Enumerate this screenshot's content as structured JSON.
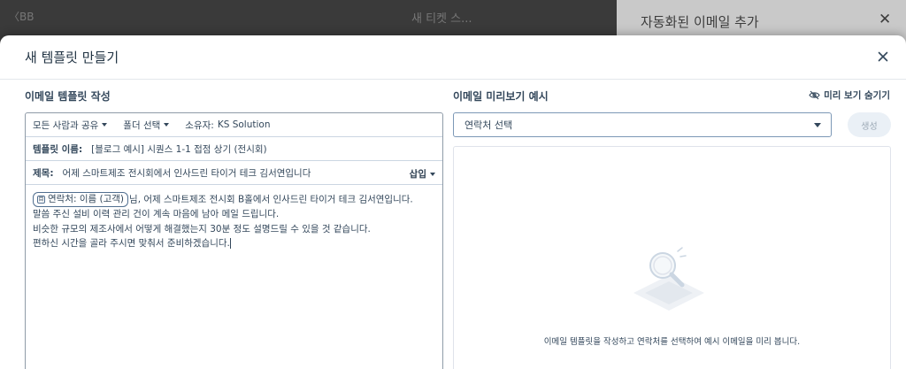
{
  "background": {
    "title": "새 티켓 스...",
    "left_text": "〈BB",
    "panel_title": "자동화된 이메일 추가",
    "panel_close": "✕"
  },
  "modal": {
    "title": "새 템플릿 만들기"
  },
  "editor": {
    "title": "이메일 템플릿 작성",
    "toolbar": {
      "share": "모든 사람과 공유",
      "folder": "폴더 선택",
      "owner_label": "소유자:",
      "owner_value": "KS Solution"
    },
    "template_name_label": "템플릿 이름:",
    "template_name_value": "[블로그 예시] 시퀀스 1-1 접점 상기 (전시회)",
    "subject_label": "제목:",
    "subject_value": "어제 스마트제조 전시회에서 인사드린 타이거 테크 김서연입니다",
    "insert_label": "삽입",
    "token_label": "연락처: 이름 (고객)",
    "token_icon": "目",
    "body_line1_rest": "님, 어제 스마트제조 전시회 B홀에서 인사드린 타이거 테크 김서연입니다.",
    "body_line2": "말씀 주신 설비 이력 관리 건이 계속 마음에 남아 메일 드립니다.",
    "body_line3": "비슷한 규모의 제조사에서 어떻게 해결했는지 30분 정도 설명드릴 수 있을 것 같습니다.",
    "body_line4": "편하신 시간을 골라 주시면 맞춰서 준비하겠습니다."
  },
  "preview": {
    "title": "이메일 미리보기 예시",
    "hide_label": "미리 보기 숨기기",
    "contact_select": "연락처 선택",
    "generate_button": "생성",
    "empty_text": "이메일 템플릿을 작성하고 연락처를 선택하여 예시 이메일을 미리 봅니다."
  }
}
